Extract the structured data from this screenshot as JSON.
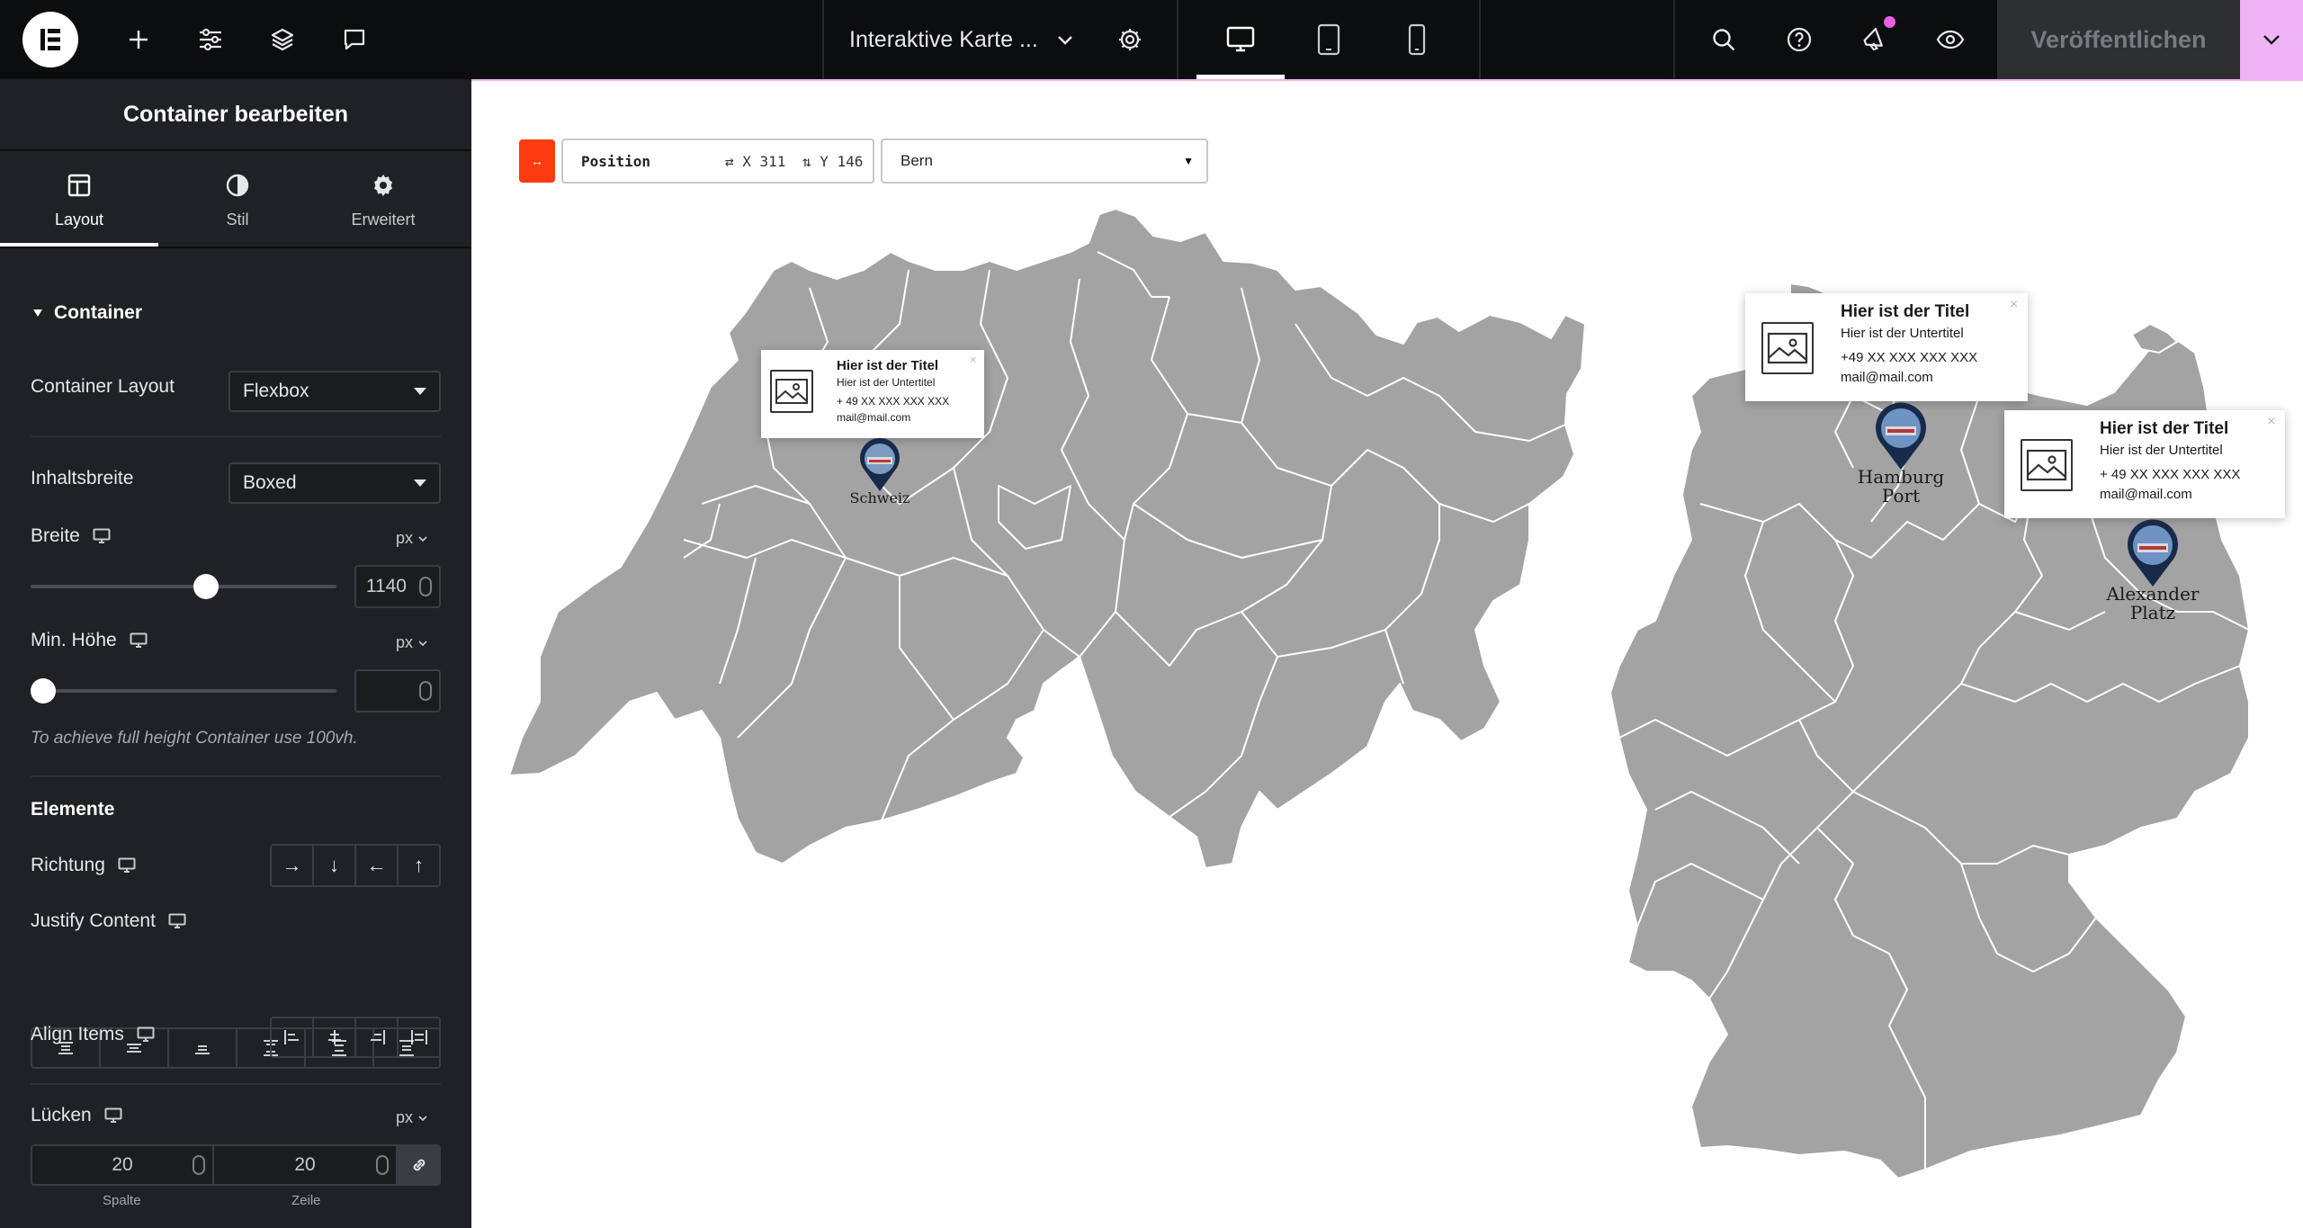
{
  "topbar": {
    "doc_title": "Interaktive Karte ...",
    "publish_label": "Veröffentlichen",
    "icons": [
      "elementor-logo-icon",
      "plus-icon",
      "sliders-icon",
      "layers-icon",
      "comment-icon",
      "chevron-down-icon",
      "gear-icon",
      "desktop-icon",
      "tablet-icon",
      "mobile-icon",
      "search-icon",
      "help-icon",
      "megaphone-icon",
      "eye-icon"
    ]
  },
  "panel": {
    "title": "Container bearbeiten",
    "tabs": [
      {
        "label": "Layout",
        "icon": "layout-icon",
        "active": true
      },
      {
        "label": "Stil",
        "icon": "contrast-icon",
        "active": false
      },
      {
        "label": "Erweitert",
        "icon": "gear-icon",
        "active": false
      }
    ],
    "section_container": "Container",
    "container_layout_label": "Container Layout",
    "container_layout_value": "Flexbox",
    "content_width_label": "Inhaltsbreite",
    "content_width_value": "Boxed",
    "width_label": "Breite",
    "width_unit": "px",
    "width_value": "1140",
    "width_slider_fraction": 0.58,
    "min_height_label": "Min. Höhe",
    "min_height_unit": "px",
    "min_height_value": "",
    "min_height_slider_fraction": 0.0,
    "hint": "To achieve full height Container use 100vh.",
    "section_elements": "Elemente",
    "direction_label": "Richtung",
    "direction_buttons": [
      "→",
      "↓",
      "←",
      "↑"
    ],
    "justify_label": "Justify Content",
    "align_label": "Align Items",
    "gaps_label": "Lücken",
    "gaps_unit": "px",
    "gap_column": "20",
    "gap_row": "20",
    "gap_column_label": "Spalte",
    "gap_row_label": "Zeile"
  },
  "canvas": {
    "position_label": "Position",
    "pos_x": "⇄ X  311",
    "pos_y": "⇅ Y  146",
    "location_value": "Bern",
    "toggle_glyph": "↔"
  },
  "cards": [
    {
      "title": "Hier ist der Titel",
      "subtitle": "Hier ist der Untertitel",
      "phone": "+ 49 XX XXX XXX XXX",
      "mail": "mail@mail.com"
    },
    {
      "title": "Hier ist der Titel",
      "subtitle": "Hier ist der Untertitel",
      "phone": "+49 XX XXX XXX XXX",
      "mail": "mail@mail.com"
    },
    {
      "title": "Hier ist der Titel",
      "subtitle": "Hier ist der Untertitel",
      "phone": "+ 49 XX XXX XXX XXX",
      "mail": "mail@mail.com"
    }
  ],
  "pins": [
    {
      "label": "Schweiz"
    },
    {
      "label_line1": "Hamburg",
      "label_line2": "Port"
    },
    {
      "label_line1": "Alexander",
      "label_line2": "Platz"
    }
  ],
  "colors": {
    "map_fill": "#a3a3a3",
    "map_border": "#ffffff",
    "accent_pink": "#f0b3f5",
    "toggle_red": "#ff3b0f",
    "pin_navy": "#172a4a"
  }
}
